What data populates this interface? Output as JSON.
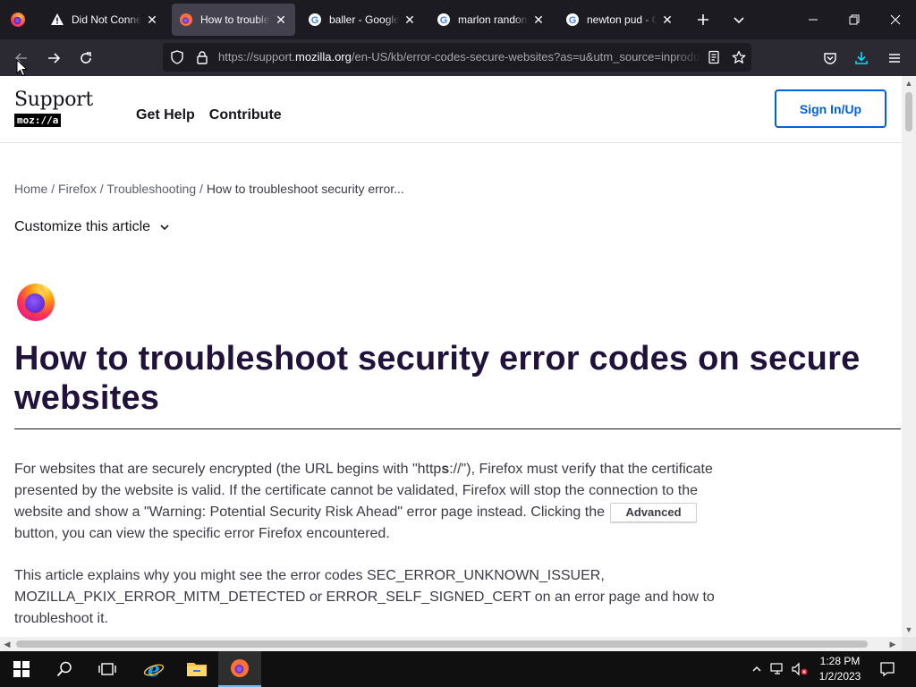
{
  "tabs": [
    {
      "label": "Did Not Connect: Potential Security Issue",
      "icon": "warning-icon",
      "active": false
    },
    {
      "label": "How to troubleshoot security error codes",
      "icon": "firefox-icon",
      "active": true
    },
    {
      "label": "baller - Google Search",
      "icon": "google-icon",
      "active": false
    },
    {
      "label": "marlon random - Google Search",
      "icon": "google-icon",
      "active": false
    },
    {
      "label": "newton pud - Google Search",
      "icon": "google-icon",
      "active": false
    }
  ],
  "urlbar": {
    "prefix": "https://support.",
    "domain": "mozilla.org",
    "suffix": "/en-US/kb/error-codes-secure-websites?as=u&utm_source=inproduct"
  },
  "site": {
    "logo_text": "Support",
    "logo_badge": "moz://a",
    "nav": [
      "Get Help",
      "Contribute"
    ],
    "signin_label": "Sign In/Up"
  },
  "breadcrumb": {
    "items": [
      "Home",
      "Firefox",
      "Troubleshooting"
    ],
    "separator": "/",
    "current": "How to troubleshoot security error..."
  },
  "customize_label": "Customize this article",
  "article": {
    "title": "How to troubleshoot security error codes on secure websites",
    "p1_a": "For websites that are securely encrypted (the URL begins with \"http",
    "p1_strong": "s",
    "p1_b": "://\"), Firefox must verify that the certificate presented by the website is valid. If the certificate cannot be validated, Firefox will stop the connection to the website and show a \"Warning: Potential Security Risk Ahead\" error page instead. Clicking the",
    "p1_button": "Advanced",
    "p1_c": "button, you can view the specific error Firefox encountered.",
    "p2": "This article explains why you might see the error codes SEC_ERROR_UNKNOWN_ISSUER, MOZILLA_PKIX_ERROR_MITM_DETECTED or ERROR_SELF_SIGNED_CERT on an error page and how to troubleshoot it."
  },
  "taskbar": {
    "time": "1:28 PM",
    "date": "1/2/2023"
  },
  "colors": {
    "accent": "#0060df",
    "title": "#20123a",
    "browser_dark": "#1c1b22",
    "toolbar": "#2b2a33"
  }
}
